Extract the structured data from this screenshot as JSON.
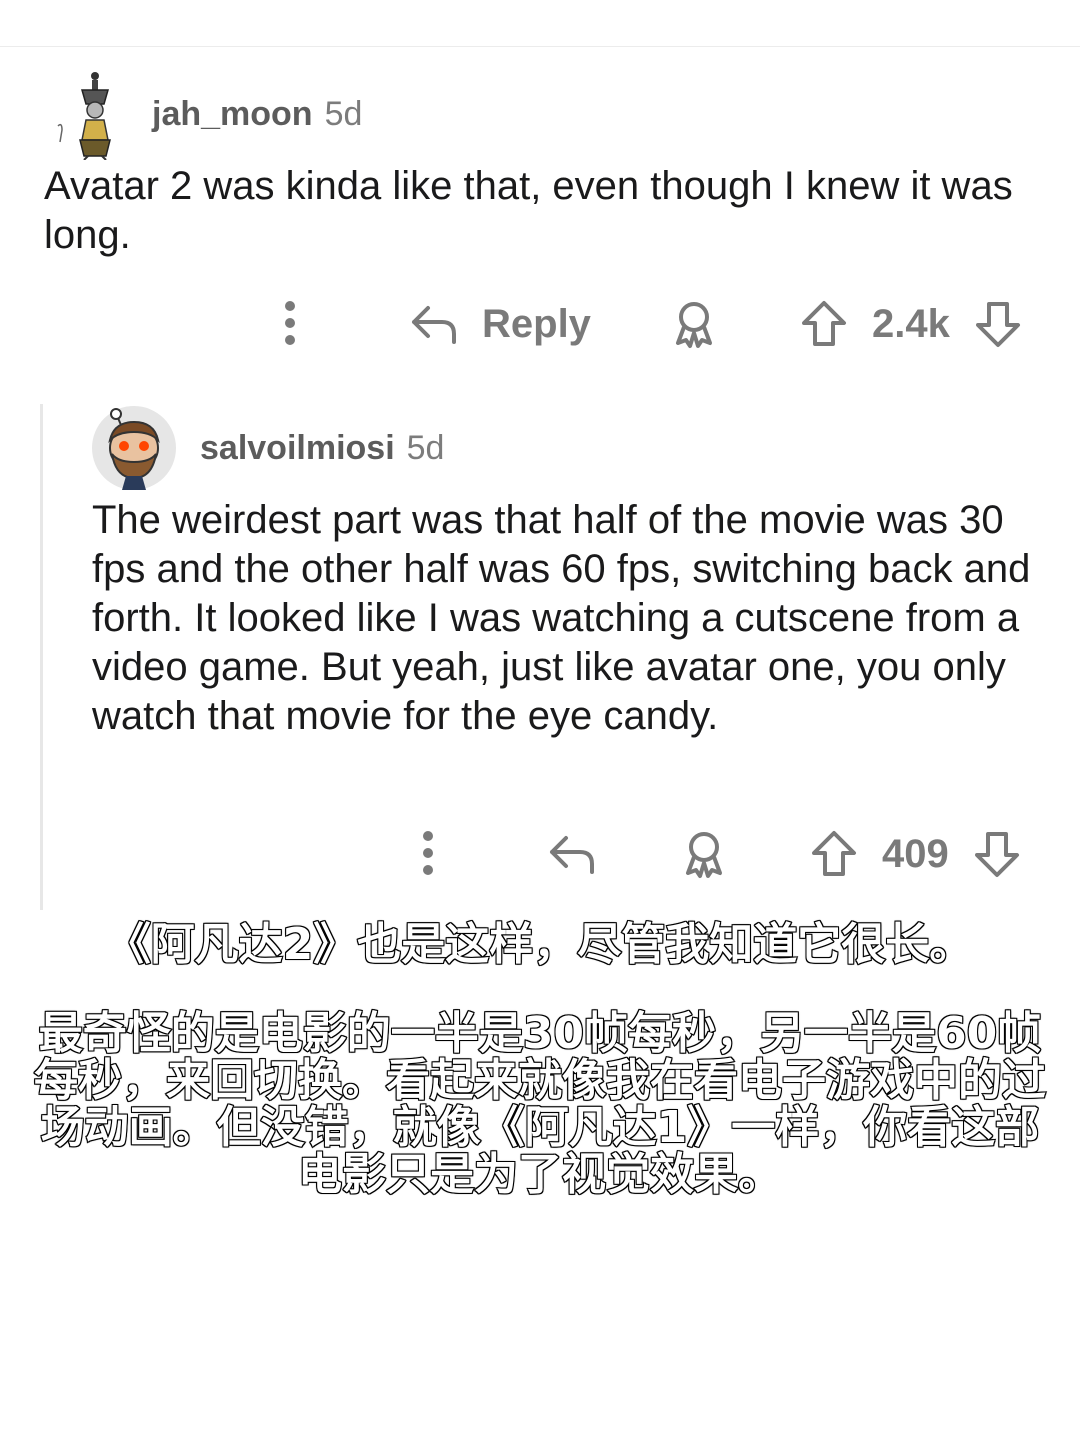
{
  "comments": [
    {
      "username": "jah_moon",
      "age": "5d",
      "body": "Avatar 2 was kinda like that, even though I knew it was long.",
      "actions": {
        "reply_label": "Reply",
        "score": "2.4k"
      }
    },
    {
      "username": "salvoilmiosi",
      "age": "5d",
      "body": "The weirdest part was that half of the movie was 30 fps and the other half was 60 fps, switching back and forth. It looked like I was watching a cutscene from a video game. But yeah, just like avatar one, you only watch that movie for the eye candy.",
      "actions": {
        "score": "409"
      }
    }
  ],
  "subtitles": {
    "line1": "《阿凡达2》也是这样，尽管我知道它很长。",
    "line2": "最奇怪的是电影的一半是30帧每秒，另一半是60帧每秒，来回切换。看起来就像我在看电子游戏中的过场动画。但没错，就像《阿凡达1》一样，你看这部电影只是为了视觉效果。"
  },
  "icons": {
    "more": "more-vertical-icon",
    "reply": "reply-arrow-icon",
    "award": "award-icon",
    "upvote": "upvote-arrow-icon",
    "downvote": "downvote-arrow-icon"
  },
  "colors": {
    "text": "#1a1a1b",
    "meta": "#7c7c7c",
    "action": "#7a7a7a",
    "thread_line": "#e7e7e7"
  }
}
